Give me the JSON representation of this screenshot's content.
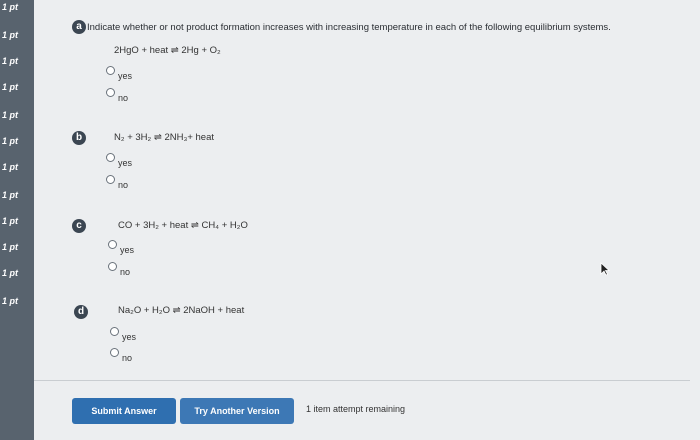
{
  "sidebar": {
    "points": [
      "1 pt",
      "1 pt",
      "1 pt",
      "1 pt",
      "1 pt",
      "1 pt",
      "1 pt",
      "1 pt",
      "1 pt",
      "1 pt",
      "1 pt",
      "1 pt"
    ]
  },
  "question": {
    "prompt": "Indicate whether or not product formation increases with increasing temperature in each of the following equilibrium systems.",
    "parts": [
      {
        "letter": "a",
        "equation": "2HgO + heat ⇌ 2Hg + O₂",
        "options": [
          "yes",
          "no"
        ]
      },
      {
        "letter": "b",
        "equation": "N₂ + 3H₂ ⇌ 2NH₃+ heat",
        "options": [
          "yes",
          "no"
        ]
      },
      {
        "letter": "c",
        "equation": "CO + 3H₂ + heat ⇌ CH₄ + H₂O",
        "options": [
          "yes",
          "no"
        ]
      },
      {
        "letter": "d",
        "equation": "Na₂O + H₂O ⇌ 2NaOH + heat",
        "options": [
          "yes",
          "no"
        ]
      }
    ]
  },
  "footer": {
    "submit_label": "Submit Answer",
    "try_another_label": "Try Another Version",
    "remaining_text": "1 item attempt remaining"
  },
  "colors": {
    "sidebar": "#58636e",
    "button": "#2f6fb0",
    "background": "#eceef0"
  }
}
